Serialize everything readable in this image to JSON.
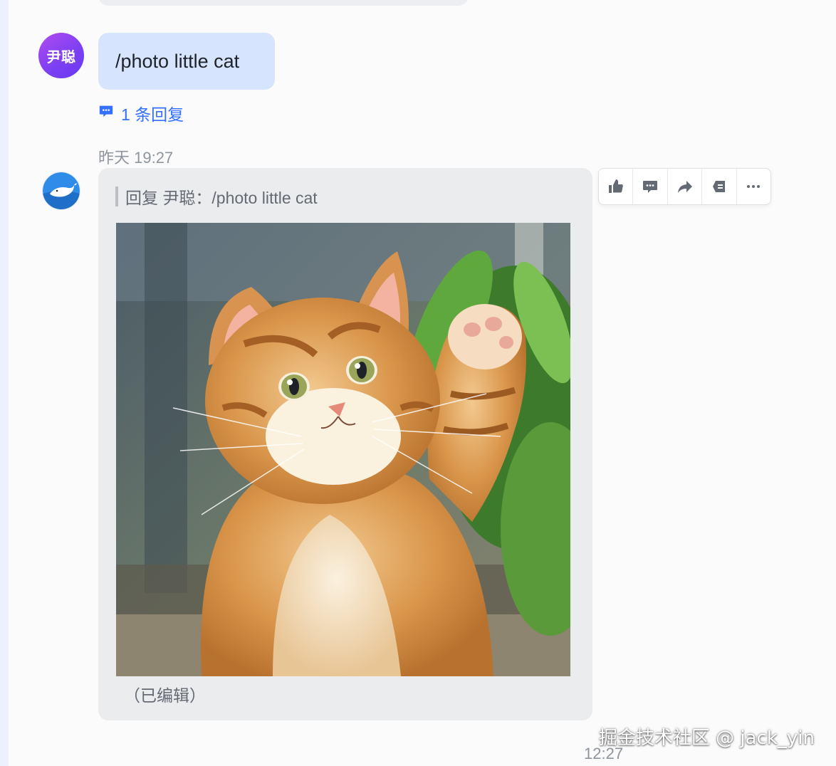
{
  "previous_message": {},
  "user_message": {
    "avatar_text": "尹聪",
    "text": "/photo little cat",
    "reply_link_label": "1 条回复",
    "reply_icon": "comment-bubble-icon"
  },
  "bot_message": {
    "timestamp": "昨天 19:27",
    "avatar_icon": "whale-bot-icon",
    "quote_text": "回复 尹聪：/photo little cat",
    "image_subject": "orange tabby kitten waving paw",
    "edited_label": "（已编辑）"
  },
  "toolbar": {
    "items": [
      {
        "name": "thumbs-up-icon"
      },
      {
        "name": "comment-icon"
      },
      {
        "name": "forward-icon"
      },
      {
        "name": "pin-icon"
      },
      {
        "name": "more-icon"
      }
    ]
  },
  "watermark": "掘金技术社区 @ jack_yin",
  "next_timestamp": "12:27",
  "colors": {
    "accent": "#3370ff",
    "user_bubble": "#d6e5fd",
    "bot_bubble": "#ebecee",
    "avatar_gradient": "#7b3ff2"
  }
}
